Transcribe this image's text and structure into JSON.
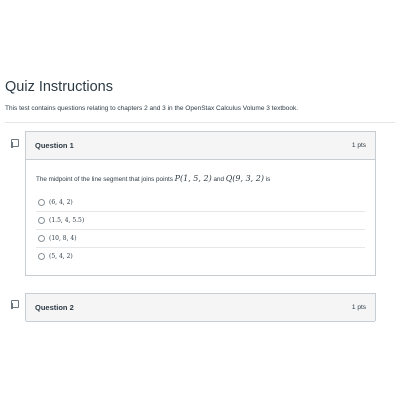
{
  "quiz": {
    "title": "Quiz Instructions",
    "description": "This test contains questions relating to chapters 2 and 3 in the OpenStax Calculus Volume 3 textbook."
  },
  "questions": [
    {
      "name": "Question 1",
      "points": "1 pts",
      "text_before": "The midpoint of the line segment that joins points ",
      "point_p": "P(1, 5, 2)",
      "text_and": " and ",
      "point_q": "Q(9, 3, 2)",
      "text_after": " is",
      "answers": [
        "(6, 4, 2)",
        "(1.5, 4, 5.5)",
        "(10, 8, 4)",
        "(5, 4, 2)"
      ]
    },
    {
      "name": "Question 2",
      "points": "1 pts"
    }
  ],
  "icons": {
    "flag": "flag-question-icon",
    "radio": "radio-unselected-icon"
  },
  "colors": {
    "text": "#2d3b45",
    "header_bg": "#f5f5f5",
    "border": "#c7cdd1"
  }
}
